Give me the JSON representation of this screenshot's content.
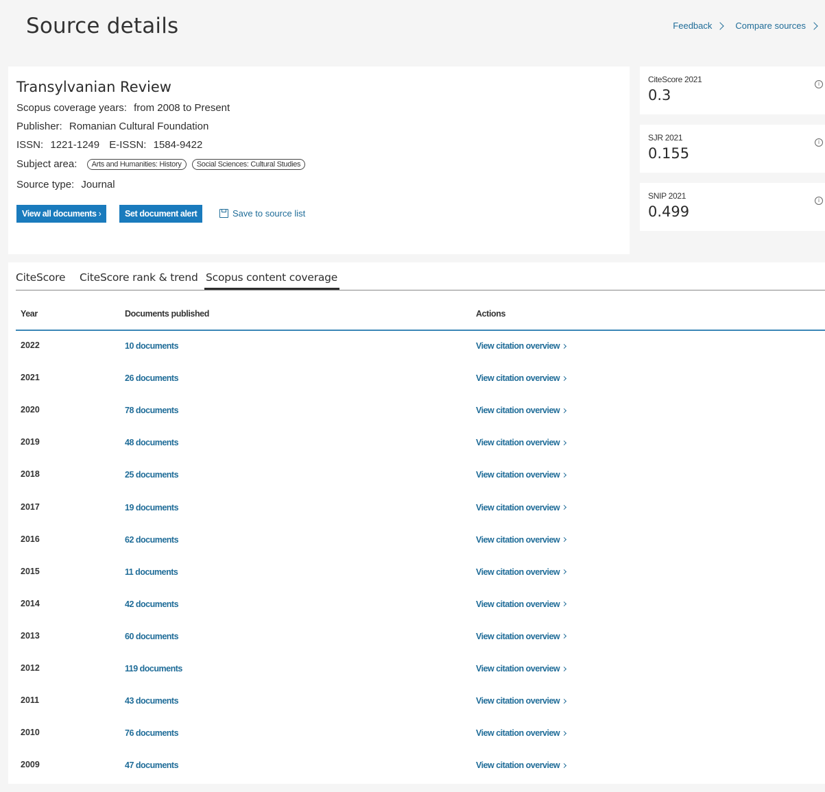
{
  "header": {
    "title": "Source details",
    "links": [
      "Feedback",
      "Compare sources"
    ]
  },
  "source": {
    "title": "Transylvanian Review",
    "coverage_label": "Scopus coverage years:",
    "coverage_value": "from 2008 to Present",
    "publisher_label": "Publisher:",
    "publisher_value": "Romanian Cultural Foundation",
    "issn_label": "ISSN:",
    "issn_value": "1221-1249",
    "eissn_label": "E-ISSN:",
    "eissn_value": "1584-9422",
    "subject_label": "Subject area:",
    "subjects": [
      "Arts and Humanities: History",
      "Social Sciences: Cultural Studies"
    ],
    "type_label": "Source type:",
    "type_value": "Journal",
    "buttons": {
      "view_all": "View all documents",
      "set_alert": "Set document alert",
      "save": "Save to source list"
    }
  },
  "metrics": [
    {
      "label": "CiteScore 2021",
      "value": "0.3"
    },
    {
      "label": "SJR 2021",
      "value": "0.155"
    },
    {
      "label": "SNIP 2021",
      "value": "0.499"
    }
  ],
  "tabs": [
    "CiteScore",
    "CiteScore rank & trend",
    "Scopus content coverage"
  ],
  "table": {
    "headers": [
      "Year",
      "Documents published",
      "Actions"
    ],
    "action_label": "View citation overview",
    "rows": [
      {
        "year": "2022",
        "docs": "10 documents"
      },
      {
        "year": "2021",
        "docs": "26 documents"
      },
      {
        "year": "2020",
        "docs": "78 documents"
      },
      {
        "year": "2019",
        "docs": "48 documents"
      },
      {
        "year": "2018",
        "docs": "25 documents"
      },
      {
        "year": "2017",
        "docs": "19 documents"
      },
      {
        "year": "2016",
        "docs": "62 documents"
      },
      {
        "year": "2015",
        "docs": "11 documents"
      },
      {
        "year": "2014",
        "docs": "42 documents"
      },
      {
        "year": "2013",
        "docs": "60 documents"
      },
      {
        "year": "2012",
        "docs": "119 documents"
      },
      {
        "year": "2011",
        "docs": "43 documents"
      },
      {
        "year": "2010",
        "docs": "76 documents"
      },
      {
        "year": "2009",
        "docs": "47 documents"
      }
    ]
  }
}
